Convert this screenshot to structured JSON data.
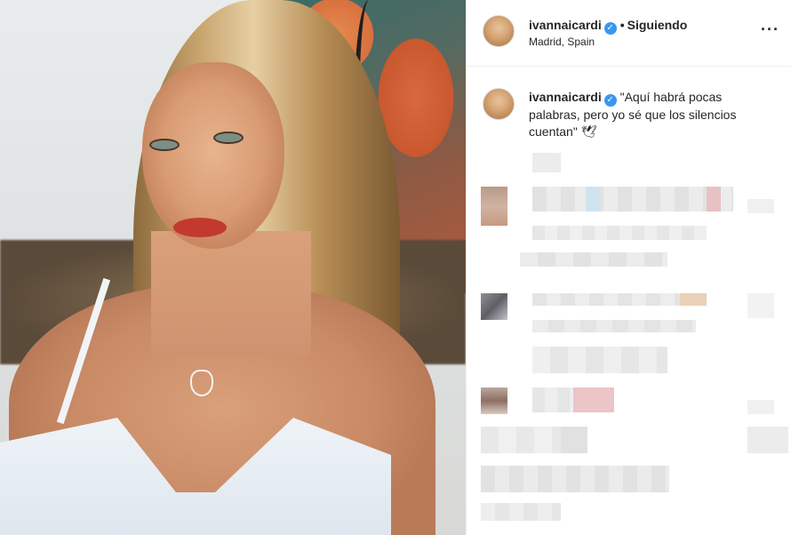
{
  "post": {
    "username": "ivannaicardi",
    "verified_mark": "✓",
    "separator": "•",
    "follow_status": "Siguiendo",
    "location": "Madrid, Spain",
    "more_label": "···",
    "caption": "\"Aquí habrá pocas palabras, pero yo sé que los silencios cuentan\"",
    "caption_emoji": "🕊"
  },
  "icons": {
    "verified": "verified-badge-icon",
    "more": "more-options-icon",
    "dove": "dove-emoji-icon"
  },
  "colors": {
    "verified_blue": "#3897f0",
    "text": "#262626",
    "border": "#efefef"
  }
}
